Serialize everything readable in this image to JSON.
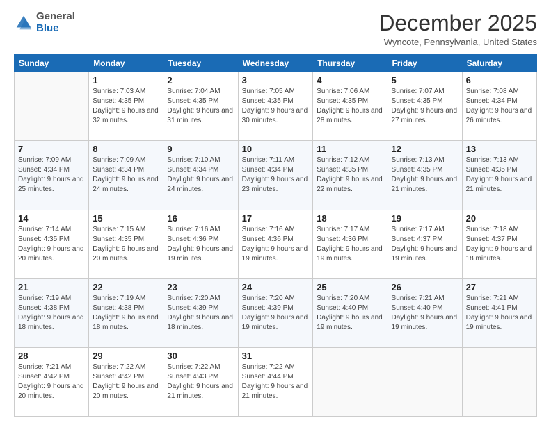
{
  "logo": {
    "general": "General",
    "blue": "Blue"
  },
  "header": {
    "title": "December 2025",
    "location": "Wyncote, Pennsylvania, United States"
  },
  "days": [
    "Sunday",
    "Monday",
    "Tuesday",
    "Wednesday",
    "Thursday",
    "Friday",
    "Saturday"
  ],
  "weeks": [
    [
      {
        "day": "",
        "sunrise": "",
        "sunset": "",
        "daylight": ""
      },
      {
        "day": "1",
        "sunrise": "Sunrise: 7:03 AM",
        "sunset": "Sunset: 4:35 PM",
        "daylight": "Daylight: 9 hours and 32 minutes."
      },
      {
        "day": "2",
        "sunrise": "Sunrise: 7:04 AM",
        "sunset": "Sunset: 4:35 PM",
        "daylight": "Daylight: 9 hours and 31 minutes."
      },
      {
        "day": "3",
        "sunrise": "Sunrise: 7:05 AM",
        "sunset": "Sunset: 4:35 PM",
        "daylight": "Daylight: 9 hours and 30 minutes."
      },
      {
        "day": "4",
        "sunrise": "Sunrise: 7:06 AM",
        "sunset": "Sunset: 4:35 PM",
        "daylight": "Daylight: 9 hours and 28 minutes."
      },
      {
        "day": "5",
        "sunrise": "Sunrise: 7:07 AM",
        "sunset": "Sunset: 4:35 PM",
        "daylight": "Daylight: 9 hours and 27 minutes."
      },
      {
        "day": "6",
        "sunrise": "Sunrise: 7:08 AM",
        "sunset": "Sunset: 4:34 PM",
        "daylight": "Daylight: 9 hours and 26 minutes."
      }
    ],
    [
      {
        "day": "7",
        "sunrise": "Sunrise: 7:09 AM",
        "sunset": "Sunset: 4:34 PM",
        "daylight": "Daylight: 9 hours and 25 minutes."
      },
      {
        "day": "8",
        "sunrise": "Sunrise: 7:09 AM",
        "sunset": "Sunset: 4:34 PM",
        "daylight": "Daylight: 9 hours and 24 minutes."
      },
      {
        "day": "9",
        "sunrise": "Sunrise: 7:10 AM",
        "sunset": "Sunset: 4:34 PM",
        "daylight": "Daylight: 9 hours and 24 minutes."
      },
      {
        "day": "10",
        "sunrise": "Sunrise: 7:11 AM",
        "sunset": "Sunset: 4:34 PM",
        "daylight": "Daylight: 9 hours and 23 minutes."
      },
      {
        "day": "11",
        "sunrise": "Sunrise: 7:12 AM",
        "sunset": "Sunset: 4:35 PM",
        "daylight": "Daylight: 9 hours and 22 minutes."
      },
      {
        "day": "12",
        "sunrise": "Sunrise: 7:13 AM",
        "sunset": "Sunset: 4:35 PM",
        "daylight": "Daylight: 9 hours and 21 minutes."
      },
      {
        "day": "13",
        "sunrise": "Sunrise: 7:13 AM",
        "sunset": "Sunset: 4:35 PM",
        "daylight": "Daylight: 9 hours and 21 minutes."
      }
    ],
    [
      {
        "day": "14",
        "sunrise": "Sunrise: 7:14 AM",
        "sunset": "Sunset: 4:35 PM",
        "daylight": "Daylight: 9 hours and 20 minutes."
      },
      {
        "day": "15",
        "sunrise": "Sunrise: 7:15 AM",
        "sunset": "Sunset: 4:35 PM",
        "daylight": "Daylight: 9 hours and 20 minutes."
      },
      {
        "day": "16",
        "sunrise": "Sunrise: 7:16 AM",
        "sunset": "Sunset: 4:36 PM",
        "daylight": "Daylight: 9 hours and 19 minutes."
      },
      {
        "day": "17",
        "sunrise": "Sunrise: 7:16 AM",
        "sunset": "Sunset: 4:36 PM",
        "daylight": "Daylight: 9 hours and 19 minutes."
      },
      {
        "day": "18",
        "sunrise": "Sunrise: 7:17 AM",
        "sunset": "Sunset: 4:36 PM",
        "daylight": "Daylight: 9 hours and 19 minutes."
      },
      {
        "day": "19",
        "sunrise": "Sunrise: 7:17 AM",
        "sunset": "Sunset: 4:37 PM",
        "daylight": "Daylight: 9 hours and 19 minutes."
      },
      {
        "day": "20",
        "sunrise": "Sunrise: 7:18 AM",
        "sunset": "Sunset: 4:37 PM",
        "daylight": "Daylight: 9 hours and 18 minutes."
      }
    ],
    [
      {
        "day": "21",
        "sunrise": "Sunrise: 7:19 AM",
        "sunset": "Sunset: 4:38 PM",
        "daylight": "Daylight: 9 hours and 18 minutes."
      },
      {
        "day": "22",
        "sunrise": "Sunrise: 7:19 AM",
        "sunset": "Sunset: 4:38 PM",
        "daylight": "Daylight: 9 hours and 18 minutes."
      },
      {
        "day": "23",
        "sunrise": "Sunrise: 7:20 AM",
        "sunset": "Sunset: 4:39 PM",
        "daylight": "Daylight: 9 hours and 18 minutes."
      },
      {
        "day": "24",
        "sunrise": "Sunrise: 7:20 AM",
        "sunset": "Sunset: 4:39 PM",
        "daylight": "Daylight: 9 hours and 19 minutes."
      },
      {
        "day": "25",
        "sunrise": "Sunrise: 7:20 AM",
        "sunset": "Sunset: 4:40 PM",
        "daylight": "Daylight: 9 hours and 19 minutes."
      },
      {
        "day": "26",
        "sunrise": "Sunrise: 7:21 AM",
        "sunset": "Sunset: 4:40 PM",
        "daylight": "Daylight: 9 hours and 19 minutes."
      },
      {
        "day": "27",
        "sunrise": "Sunrise: 7:21 AM",
        "sunset": "Sunset: 4:41 PM",
        "daylight": "Daylight: 9 hours and 19 minutes."
      }
    ],
    [
      {
        "day": "28",
        "sunrise": "Sunrise: 7:21 AM",
        "sunset": "Sunset: 4:42 PM",
        "daylight": "Daylight: 9 hours and 20 minutes."
      },
      {
        "day": "29",
        "sunrise": "Sunrise: 7:22 AM",
        "sunset": "Sunset: 4:42 PM",
        "daylight": "Daylight: 9 hours and 20 minutes."
      },
      {
        "day": "30",
        "sunrise": "Sunrise: 7:22 AM",
        "sunset": "Sunset: 4:43 PM",
        "daylight": "Daylight: 9 hours and 21 minutes."
      },
      {
        "day": "31",
        "sunrise": "Sunrise: 7:22 AM",
        "sunset": "Sunset: 4:44 PM",
        "daylight": "Daylight: 9 hours and 21 minutes."
      },
      {
        "day": "",
        "sunrise": "",
        "sunset": "",
        "daylight": ""
      },
      {
        "day": "",
        "sunrise": "",
        "sunset": "",
        "daylight": ""
      },
      {
        "day": "",
        "sunrise": "",
        "sunset": "",
        "daylight": ""
      }
    ]
  ]
}
